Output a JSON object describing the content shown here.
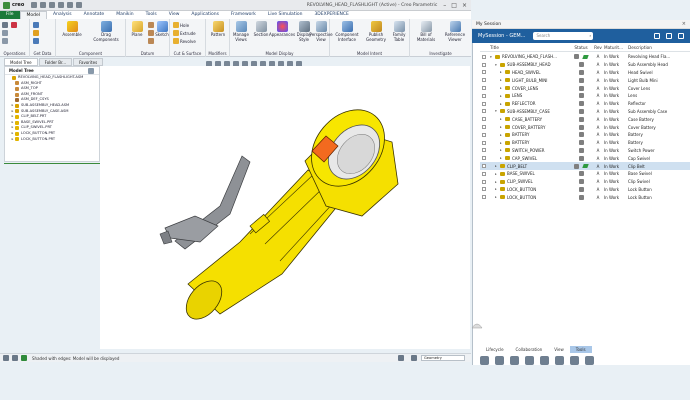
{
  "app": {
    "logo": "creo",
    "window_title": "REVOLVING_HEAD_FLASHLIGHT (Active) - Creo Parametric"
  },
  "ribbon_tabs": [
    "File",
    "Model",
    "Analysis",
    "Annotate",
    "Manikin",
    "Tools",
    "View",
    "Applications",
    "Framework",
    "Live Simulation",
    "3DEXPERIENCE"
  ],
  "active_tab": "Model",
  "ribbon": {
    "operations": {
      "label": "Operations",
      "items": [
        "Regenerate",
        "Copy",
        "Paste"
      ]
    },
    "get_data": {
      "label": "Get Data",
      "items": [
        "User-Defined Feature",
        "Copy Geometry",
        "Shrinkwrap"
      ]
    },
    "component": {
      "label": "Component",
      "assemble": "Assemble",
      "drag": "Drag Components"
    },
    "datum": {
      "label": "Datum",
      "plane": "Plane",
      "sketch": "Sketch"
    },
    "cut_surface": {
      "label": "Cut & Surface",
      "items": [
        "Hole",
        "Extrude",
        "Revolve"
      ]
    },
    "modifiers": {
      "label": "Modifiers",
      "pattern": "Pattern"
    },
    "model_display": {
      "label": "Model Display",
      "items": [
        "Manage Views",
        "Section",
        "Appearances",
        "Display Style",
        "Perspective View"
      ]
    },
    "model_intent": {
      "label": "Model Intent",
      "items": [
        "Component Interface",
        "Publish Geometry",
        "Family Table"
      ]
    },
    "investigate": {
      "label": "Investigate",
      "items": [
        "Bill of Materials",
        "Reference Viewer"
      ]
    }
  },
  "nav_tabs": [
    "Model Tree",
    "Folder Br...",
    "Favorites"
  ],
  "tree": {
    "header": "Model Tree",
    "items": [
      {
        "label": "REVOLVING_HEAD_FLASHLIGHT.ASM",
        "level": 0,
        "type": "asm"
      },
      {
        "label": "ASM_RIGHT",
        "level": 1,
        "type": "datum"
      },
      {
        "label": "ASM_TOP",
        "level": 1,
        "type": "datum"
      },
      {
        "label": "ASM_FRONT",
        "level": 1,
        "type": "datum"
      },
      {
        "label": "ASM_DEF_CSYS",
        "level": 1,
        "type": "csys"
      },
      {
        "label": "SUB-ASSEMBLY_HEAD.ASM",
        "level": 1,
        "type": "asm"
      },
      {
        "label": "SUB-ASSEMBLY_CASE.ASM",
        "level": 1,
        "type": "asm"
      },
      {
        "label": "CLIP_BELT.PRT",
        "level": 1,
        "type": "prt"
      },
      {
        "label": "BASE_SWIVEL.PRT",
        "level": 1,
        "type": "prt"
      },
      {
        "label": "CLIP_SWIVEL.PRT",
        "level": 1,
        "type": "prt"
      },
      {
        "label": "LOCK_BUTTON.PRT",
        "level": 1,
        "type": "prt"
      },
      {
        "label": "LOCK_BUTTON.PRT",
        "level": 1,
        "type": "prt"
      }
    ]
  },
  "status": {
    "message": "Shaded with edges: Model will be displayed",
    "filter": "Geometry"
  },
  "session": {
    "window_title": "My Session",
    "header": "MySession - GEM...",
    "search_placeholder": "Search",
    "columns": [
      "Title",
      "Status",
      "Rev",
      "Maturit...",
      "Description"
    ],
    "rows": [
      {
        "title": "REVOLVING_HEAD_FLASH...",
        "level": 0,
        "rev": "A",
        "maturity": "In Work",
        "desc": "Revolving Head Fla...",
        "expanded": true,
        "green": true
      },
      {
        "title": "SUB-ASSEMBLY_HEAD",
        "level": 1,
        "rev": "A",
        "maturity": "In Work",
        "desc": "Sub Assembly Head",
        "expanded": true,
        "green": false
      },
      {
        "title": "HEAD_SWIVEL",
        "level": 2,
        "rev": "A",
        "maturity": "In Work",
        "desc": "Head Swivel",
        "green": false
      },
      {
        "title": "LIGHT_BULB_MINI",
        "level": 2,
        "rev": "A",
        "maturity": "In Work",
        "desc": "Light Bulb Mini",
        "green": false
      },
      {
        "title": "COVER_LENS",
        "level": 2,
        "rev": "A",
        "maturity": "In Work",
        "desc": "Cover Lens",
        "green": false
      },
      {
        "title": "LENS",
        "level": 2,
        "rev": "A",
        "maturity": "In Work",
        "desc": "Lens",
        "green": false
      },
      {
        "title": "REFLECTOR",
        "level": 2,
        "rev": "A",
        "maturity": "In Work",
        "desc": "Reflector",
        "green": false
      },
      {
        "title": "SUB-ASSEMBLY_CASE",
        "level": 1,
        "rev": "A",
        "maturity": "In Work",
        "desc": "Sub Assembly Case",
        "expanded": true,
        "green": false
      },
      {
        "title": "CASE_BATTERY",
        "level": 2,
        "rev": "A",
        "maturity": "In Work",
        "desc": "Case Battery",
        "green": false
      },
      {
        "title": "COVER_BATTERY",
        "level": 2,
        "rev": "A",
        "maturity": "In Work",
        "desc": "Cover Battery",
        "green": false
      },
      {
        "title": "BATTERY",
        "level": 2,
        "rev": "A",
        "maturity": "In Work",
        "desc": "Battery",
        "green": false
      },
      {
        "title": "BATTERY",
        "level": 2,
        "rev": "A",
        "maturity": "In Work",
        "desc": "Battery",
        "green": false
      },
      {
        "title": "SWITCH_POWER",
        "level": 2,
        "rev": "A",
        "maturity": "In Work",
        "desc": "Switch Power",
        "green": false
      },
      {
        "title": "CAP_SWIVEL",
        "level": 2,
        "rev": "A",
        "maturity": "In Work",
        "desc": "Cap Swivel",
        "green": false
      },
      {
        "title": "CLIP_BELT",
        "level": 1,
        "rev": "A",
        "maturity": "In Work",
        "desc": "Clip Belt",
        "green": true,
        "selected": true
      },
      {
        "title": "BASE_SWIVEL",
        "level": 1,
        "rev": "A",
        "maturity": "In Work",
        "desc": "Base Swivel",
        "green": false
      },
      {
        "title": "CLIP_SWIVEL",
        "level": 1,
        "rev": "A",
        "maturity": "In Work",
        "desc": "Clip Swivel",
        "green": false
      },
      {
        "title": "LOCK_BUTTON",
        "level": 1,
        "rev": "A",
        "maturity": "In Work",
        "desc": "Lock Button",
        "green": false
      },
      {
        "title": "LOCK_BUTTON",
        "level": 1,
        "rev": "A",
        "maturity": "In Work",
        "desc": "Lock Button",
        "green": false
      }
    ],
    "bottom_tabs": [
      "Lifecycle",
      "Collaboration",
      "View",
      "Tools"
    ],
    "active_bottom_tab": "Tools"
  },
  "colors": {
    "file_tab": "#1b7a39",
    "session_bar": "#1f5f9e",
    "model_yellow": "#f5e000",
    "model_gray": "#8a8d92",
    "lens_orange": "#f36a1f"
  }
}
